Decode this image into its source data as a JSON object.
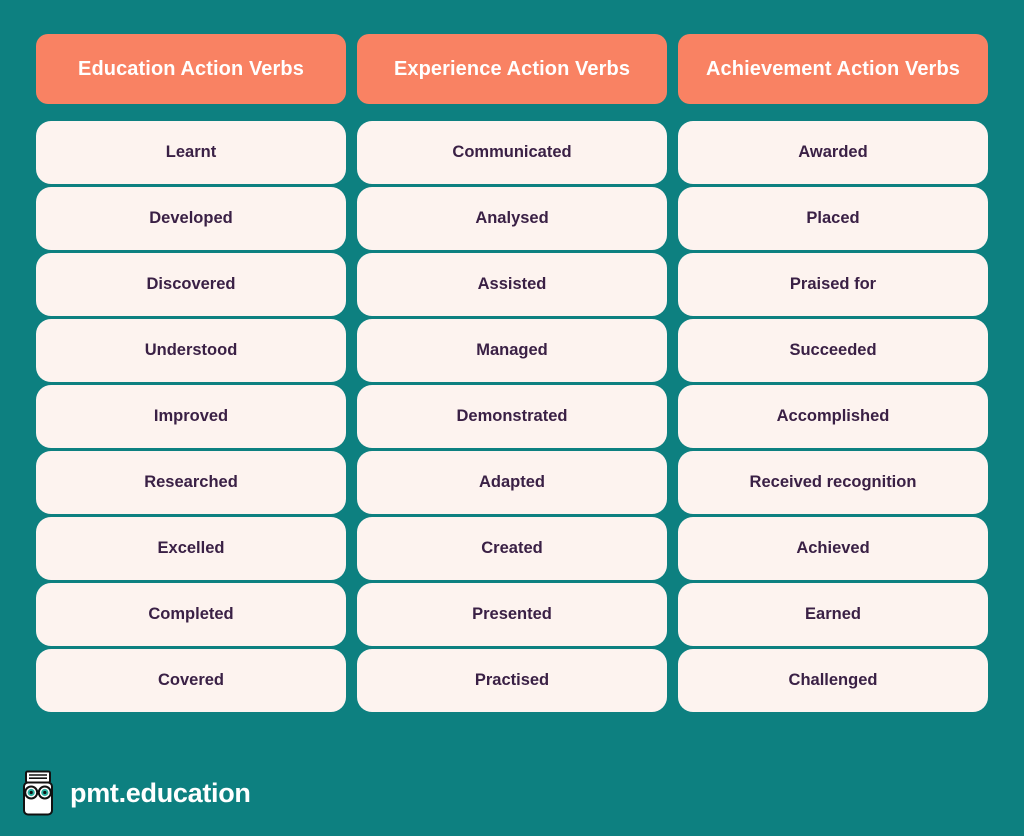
{
  "theme": {
    "background": "#0d8080",
    "header_bg": "#f98263",
    "header_text": "#ffffff",
    "cell_bg": "#fdf3ef",
    "cell_text": "#3a2045",
    "logo_text_color": "#ffffff"
  },
  "table": {
    "columns": [
      {
        "header": "Education Action Verbs",
        "verbs": [
          "Learnt",
          "Developed",
          "Discovered",
          "Understood",
          "Improved",
          "Researched",
          "Excelled",
          "Completed",
          "Covered"
        ]
      },
      {
        "header": "Experience Action Verbs",
        "verbs": [
          "Communicated",
          "Analysed",
          "Assisted",
          "Managed",
          "Demonstrated",
          "Adapted",
          "Created",
          "Presented",
          "Practised"
        ]
      },
      {
        "header": "Achievement Action Verbs",
        "verbs": [
          "Awarded",
          "Placed",
          "Praised for",
          "Succeeded",
          "Accomplished",
          "Received recognition",
          "Achieved",
          "Earned",
          "Challenged"
        ]
      }
    ]
  },
  "footer": {
    "logo_icon": "pmt-books-glasses-mascot-icon",
    "brand": "pmt.education"
  }
}
